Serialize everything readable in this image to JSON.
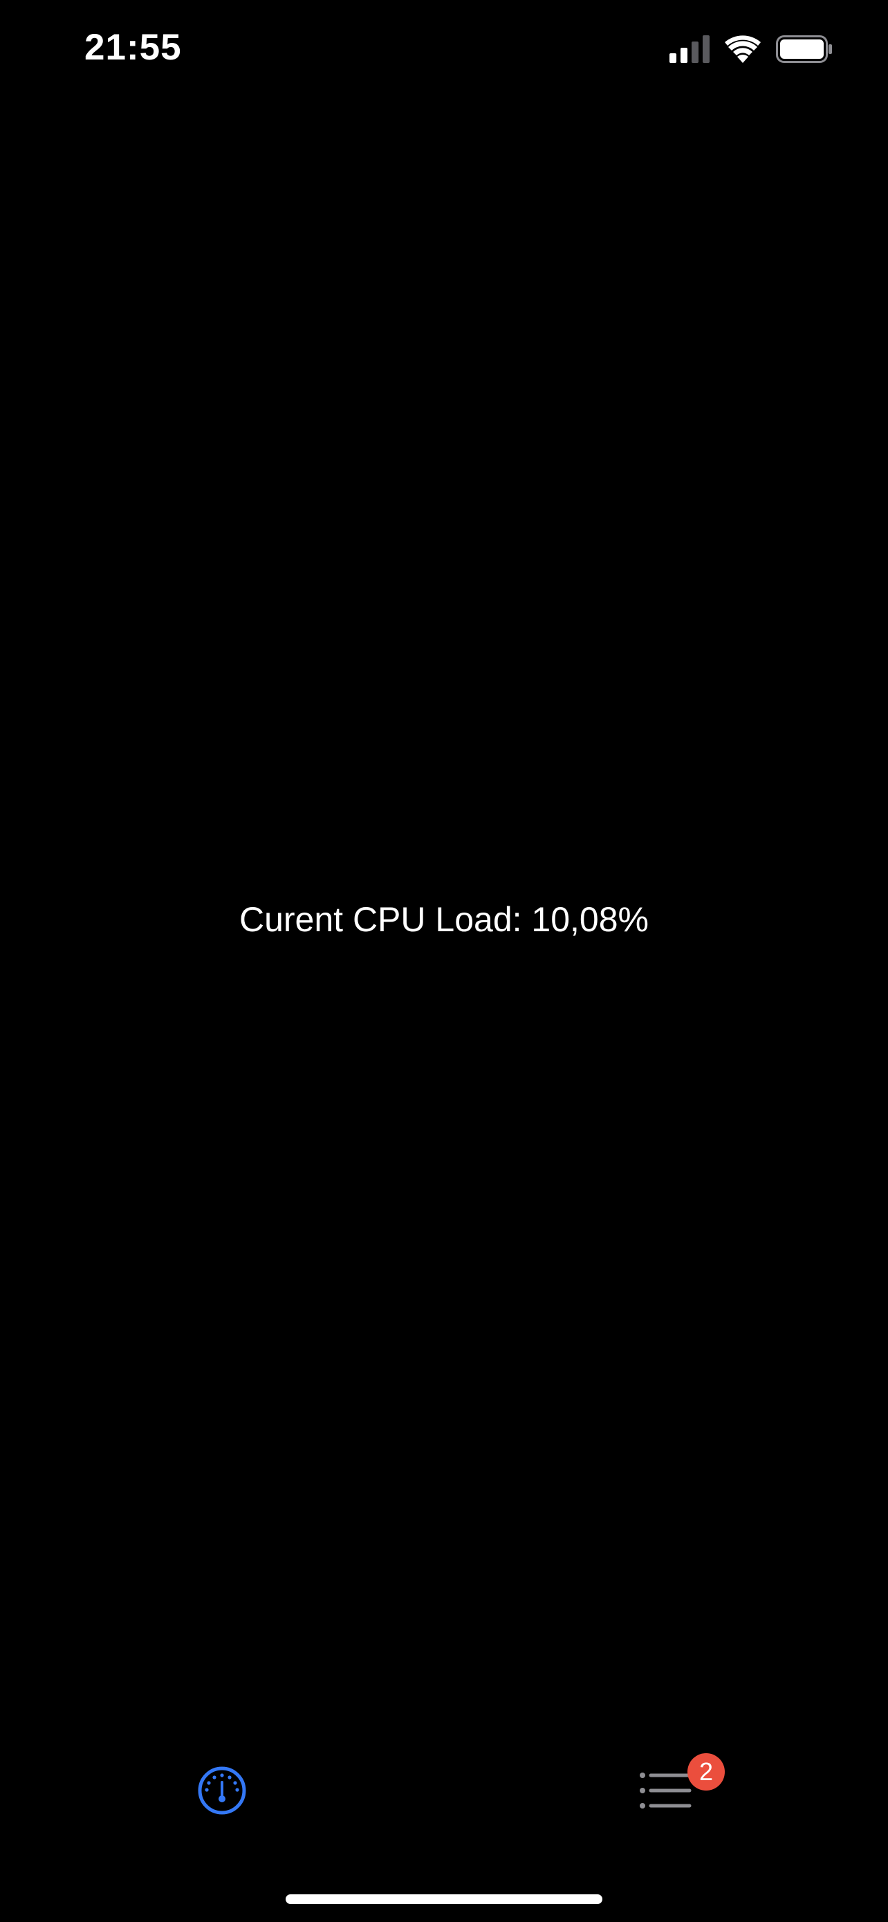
{
  "status_bar": {
    "time": "21:55",
    "icons": [
      "cellular-signal-icon",
      "wifi-icon",
      "battery-icon"
    ]
  },
  "main": {
    "cpu_load_text": "Curent CPU Load: 10,08%"
  },
  "tab_bar": {
    "items": [
      {
        "name": "monitor",
        "icon": "gauge-icon",
        "selected": true
      },
      {
        "name": "list",
        "icon": "list-icon",
        "selected": false,
        "badge": "2"
      }
    ]
  },
  "colors": {
    "background": "#000000",
    "text": "#ffffff",
    "accent": "#3478F6",
    "inactive": "#8E8E93",
    "badge": "#EB4E3D"
  }
}
